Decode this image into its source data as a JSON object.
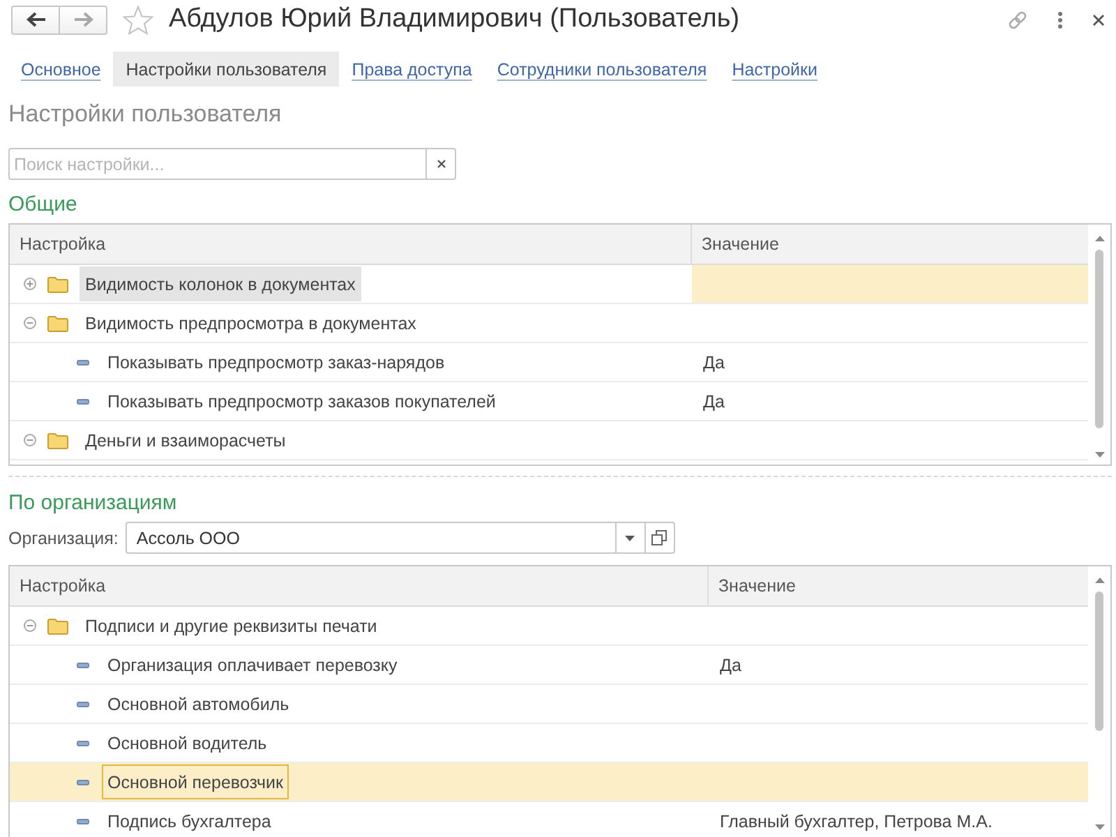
{
  "window": {
    "title": "Абдулов Юрий Владимирович (Пользователь)",
    "favorite": false
  },
  "navigation": [
    {
      "kind": "back",
      "disabled": false
    },
    {
      "kind": "forward",
      "disabled": true
    }
  ],
  "tabs": [
    {
      "label": "Основное",
      "selected": false
    },
    {
      "label": "Настройки пользователя",
      "selected": true
    },
    {
      "label": "Права доступа",
      "selected": false
    },
    {
      "label": "Сотрудники пользователя",
      "selected": false
    },
    {
      "label": "Настройки",
      "selected": false
    }
  ],
  "page_title": "Настройки пользователя",
  "search": {
    "placeholder": "Поиск настройки..."
  },
  "general": {
    "title": "Общие",
    "active": false,
    "columns": [
      "Настройка",
      "Значение"
    ],
    "rows": [
      {
        "kind": "group",
        "name": "Видимость колонок в документах",
        "expanded": false,
        "selected": true
      },
      {
        "kind": "group",
        "name": "Видимость предпросмотра в документах",
        "expanded": true,
        "selected": false,
        "children": [
          {
            "kind": "setting",
            "name": "Показывать предпросмотр заказ-нарядов",
            "value": "Да",
            "selected": false
          },
          {
            "kind": "setting",
            "name": "Показывать предпросмотр заказов покупателей",
            "value": "Да",
            "selected": false
          }
        ]
      },
      {
        "kind": "group",
        "name": "Деньги и взаиморасчеты",
        "expanded": true,
        "selected": false
      }
    ]
  },
  "by_organization": {
    "title": "По организациям",
    "organization": {
      "label": "Организация:",
      "value": "Ассоль ООО"
    },
    "active": true,
    "columns": [
      "Настройка",
      "Значение"
    ],
    "rows": [
      {
        "kind": "group",
        "name": "Подписи и другие реквизиты печати",
        "expanded": true,
        "selected": false,
        "children": [
          {
            "kind": "setting",
            "name": "Организация оплачивает перевозку",
            "value": "Да",
            "selected": false
          },
          {
            "kind": "setting",
            "name": "Основной автомобиль",
            "selected": false
          },
          {
            "kind": "setting",
            "name": "Основной водитель",
            "selected": false
          },
          {
            "kind": "setting",
            "name": "Основной перевозчик",
            "selected": true
          },
          {
            "kind": "setting",
            "name": "Подпись бухгалтера",
            "value": "Главный бухгалтер, Петрова М.А.",
            "selected": false
          }
        ]
      }
    ]
  }
}
